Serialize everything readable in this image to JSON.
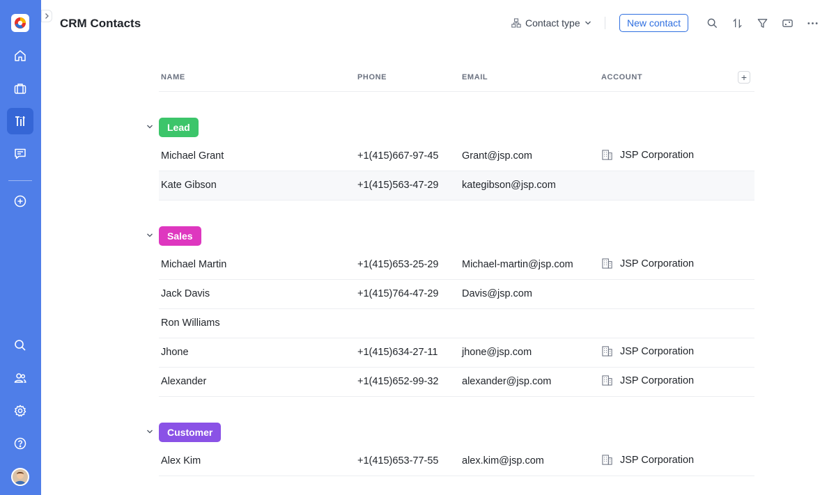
{
  "header": {
    "title": "CRM Contacts",
    "contact_type_label": "Contact type",
    "new_contact_label": "New contact"
  },
  "table": {
    "columns": [
      "NAME",
      "PHONE",
      "EMAIL",
      "ACCOUNT"
    ],
    "add_column_label": "+"
  },
  "groups": [
    {
      "label": "Lead",
      "color": "#3cc56a",
      "rows": [
        {
          "name": "Michael Grant",
          "phone": "+1(415)667-97-45",
          "email": "Grant@jsp.com",
          "account": "JSP Corporation"
        },
        {
          "name": "Kate Gibson",
          "phone": "+1(415)563-47-29",
          "email": "kategibson@jsp.com",
          "account": ""
        }
      ]
    },
    {
      "label": "Sales",
      "color": "#de37bf",
      "rows": [
        {
          "name": "Michael Martin",
          "phone": "+1(415)653-25-29",
          "email": "Michael-martin@jsp.com",
          "account": "JSP Corporation"
        },
        {
          "name": "Jack Davis",
          "phone": "+1(415)764-47-29",
          "email": "Davis@jsp.com",
          "account": ""
        },
        {
          "name": "Ron Williams",
          "phone": "",
          "email": "",
          "account": ""
        },
        {
          "name": "Jhone",
          "phone": "+1(415)634-27-11",
          "email": "jhone@jsp.com",
          "account": "JSP Corporation"
        },
        {
          "name": "Alexander",
          "phone": "+1(415)652-99-32",
          "email": "alexander@jsp.com",
          "account": "JSP Corporation"
        }
      ]
    },
    {
      "label": "Customer",
      "color": "#8a52e6",
      "rows": [
        {
          "name": "Alex Kim",
          "phone": "+1(415)653-77-55",
          "email": "alex.kim@jsp.com",
          "account": "JSP Corporation"
        }
      ]
    }
  ],
  "sidebar": {
    "accent": "#4f7ee8",
    "active_item": "tools",
    "items": [
      "home-icon",
      "briefcase-icon",
      "tools-icon",
      "chat-icon",
      "add-circle-icon",
      "search-icon",
      "users-icon",
      "gear-icon",
      "help-icon"
    ]
  }
}
